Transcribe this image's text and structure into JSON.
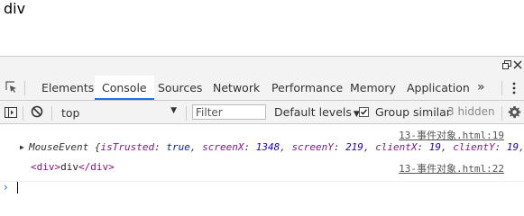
{
  "page": {
    "body_text": "div"
  },
  "devtools": {
    "tabs": [
      {
        "label": "Elements"
      },
      {
        "label": "Console",
        "active": true
      },
      {
        "label": "Sources"
      },
      {
        "label": "Network"
      },
      {
        "label": "Performance"
      },
      {
        "label": "Memory"
      },
      {
        "label": "Application"
      }
    ],
    "more_tabs_label": "»",
    "toolbar": {
      "context": "top",
      "filter_placeholder": "Filter",
      "levels_label": "Default levels",
      "group_similar_label": "Group similar",
      "group_similar_checked": true,
      "hidden_label": "3 hidden"
    },
    "messages": [
      {
        "source": "13-事件对象.html:19",
        "object_name": "MouseEvent",
        "props": [
          {
            "key": "isTrusted",
            "value": "true",
            "type": "bool"
          },
          {
            "key": "screenX",
            "value": "1348",
            "type": "num"
          },
          {
            "key": "screenY",
            "value": "219",
            "type": "num"
          },
          {
            "key": "clientX",
            "value": "19",
            "type": "num"
          },
          {
            "key": "clientY",
            "value": "19",
            "type": "num"
          }
        ]
      },
      {
        "source": "13-事件对象.html:22",
        "open_tag": "<div>",
        "text": "div",
        "close_tag": "</div>"
      }
    ],
    "prompt_symbol": "›"
  },
  "colors": {
    "active_tab_underline": "#1a73e8",
    "tag": "#881280",
    "prop_key": "#881391",
    "number": "#1c00cf"
  }
}
